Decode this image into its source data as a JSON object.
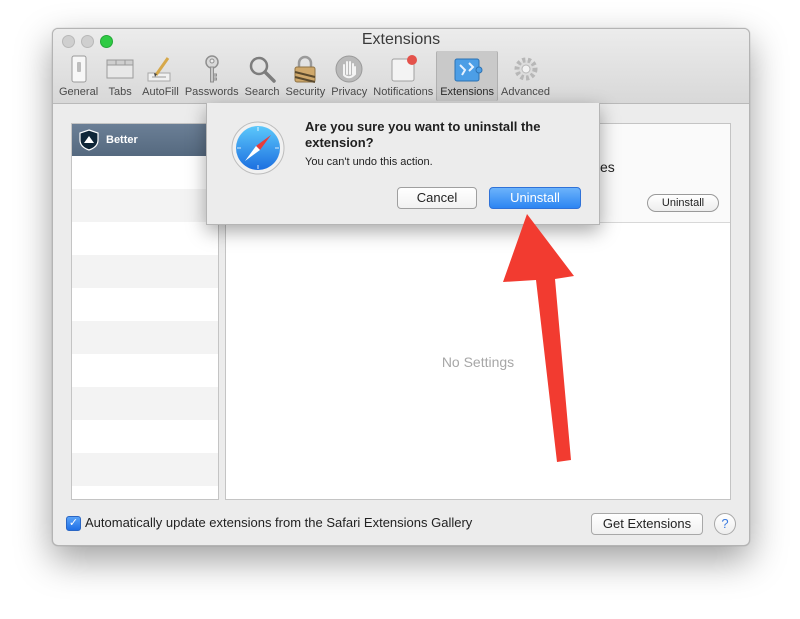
{
  "window": {
    "title": "Extensions"
  },
  "toolbar": {
    "items": [
      {
        "label": "General",
        "icon": "general-switch-icon"
      },
      {
        "label": "Tabs",
        "icon": "tabs-icon"
      },
      {
        "label": "AutoFill",
        "icon": "autofill-pencil-icon"
      },
      {
        "label": "Passwords",
        "icon": "key-icon"
      },
      {
        "label": "Search",
        "icon": "search-icon"
      },
      {
        "label": "Security",
        "icon": "lock-icon"
      },
      {
        "label": "Privacy",
        "icon": "hand-icon"
      },
      {
        "label": "Notifications",
        "icon": "notifications-icon"
      },
      {
        "label": "Extensions",
        "icon": "puzzle-icon"
      },
      {
        "label": "Advanced",
        "icon": "gear-icon"
      }
    ],
    "active": "Extensions"
  },
  "extensions_list": {
    "items": [
      {
        "name": "Better",
        "icon": "shield-icon"
      }
    ]
  },
  "detail": {
    "title_tail": "kes",
    "uninstall_label": "Uninstall",
    "empty_text": "No Settings"
  },
  "footer": {
    "auto_update_label": "Automatically update extensions from the Safari Extensions Gallery",
    "auto_update_checked": true,
    "get_extensions_label": "Get Extensions",
    "help_label": "?"
  },
  "dialog": {
    "title": "Are you sure you want to uninstall the extension?",
    "message": "You can't undo this action.",
    "cancel_label": "Cancel",
    "confirm_label": "Uninstall",
    "icon": "safari-compass-icon"
  },
  "annotation": {
    "color": "#f23b30"
  },
  "colors": {
    "accent": "#2c85f2",
    "zoom_button": "#2fcb44"
  }
}
